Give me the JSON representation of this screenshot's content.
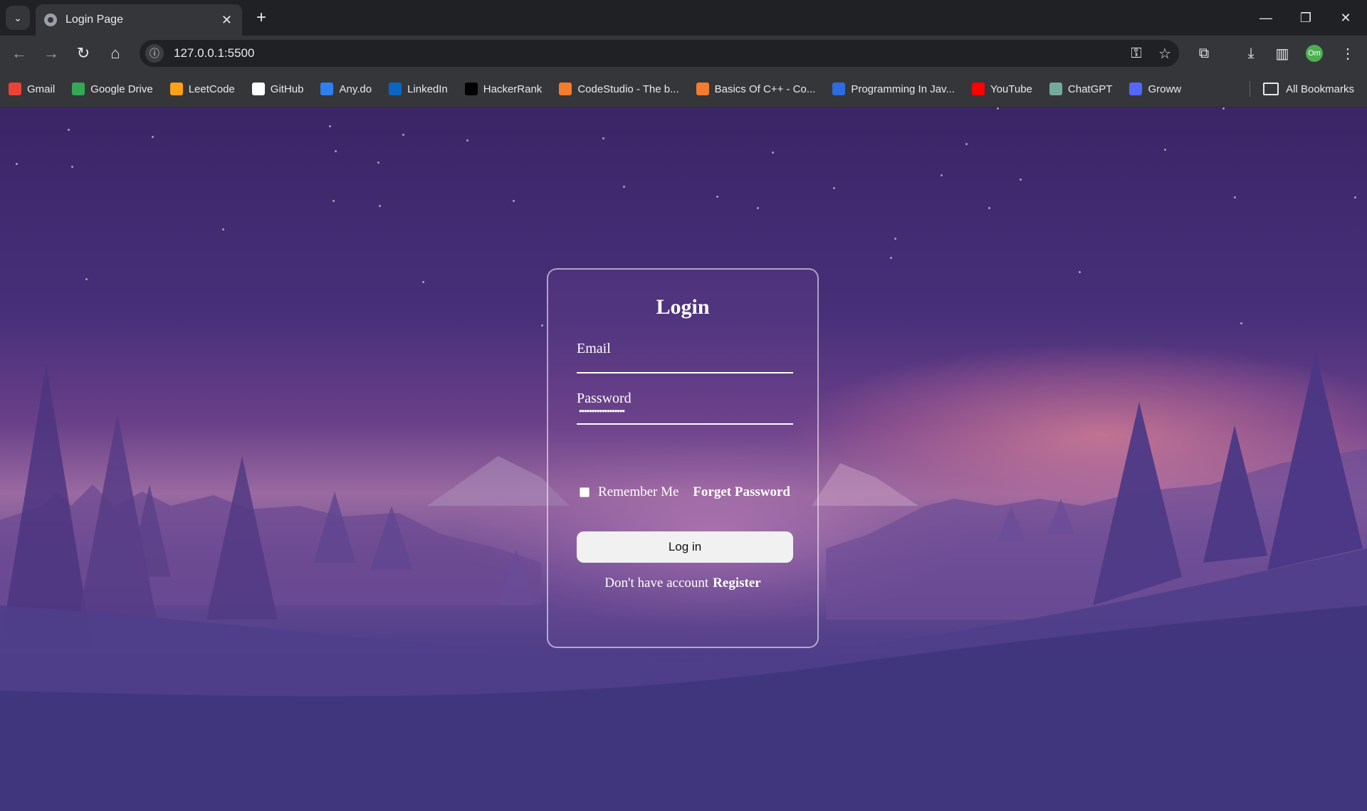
{
  "browser": {
    "tab_title": "Login Page",
    "url": "127.0.0.1:5500",
    "profile_initials": "Om",
    "bookmarks": [
      {
        "label": "Gmail",
        "icon": "gmail-icon",
        "color": "#ea4335"
      },
      {
        "label": "Google Drive",
        "icon": "google-drive-icon",
        "color": "#34a853"
      },
      {
        "label": "LeetCode",
        "icon": "leetcode-icon",
        "color": "#ffa116"
      },
      {
        "label": "GitHub",
        "icon": "github-icon",
        "color": "#ffffff"
      },
      {
        "label": "Any.do",
        "icon": "anydo-icon",
        "color": "#2f80ed"
      },
      {
        "label": "LinkedIn",
        "icon": "linkedin-icon",
        "color": "#0a66c2"
      },
      {
        "label": "HackerRank",
        "icon": "hackerrank-icon",
        "color": "#000000"
      },
      {
        "label": "CodeStudio - The b...",
        "icon": "codestudio-icon",
        "color": "#f57c2c"
      },
      {
        "label": "Basics Of C++ - Co...",
        "icon": "codestudio-icon",
        "color": "#f57c2c"
      },
      {
        "label": "Programming In Jav...",
        "icon": "scaler-icon",
        "color": "#2d6cdf"
      },
      {
        "label": "YouTube",
        "icon": "youtube-icon",
        "color": "#ff0000"
      },
      {
        "label": "ChatGPT",
        "icon": "chatgpt-icon",
        "color": "#74aa9c"
      },
      {
        "label": "Groww",
        "icon": "groww-icon",
        "color": "#5367ff"
      }
    ],
    "all_bookmarks_label": "All Bookmarks"
  },
  "login": {
    "title": "Login",
    "email_label": "Email",
    "password_label": "Password",
    "password_mask": "••••••••••••••••••",
    "remember_label": "Remember Me",
    "forgot_label": "Forget Password",
    "button_label": "Log in",
    "no_account_text": "Don't have account",
    "register_label": "Register"
  }
}
